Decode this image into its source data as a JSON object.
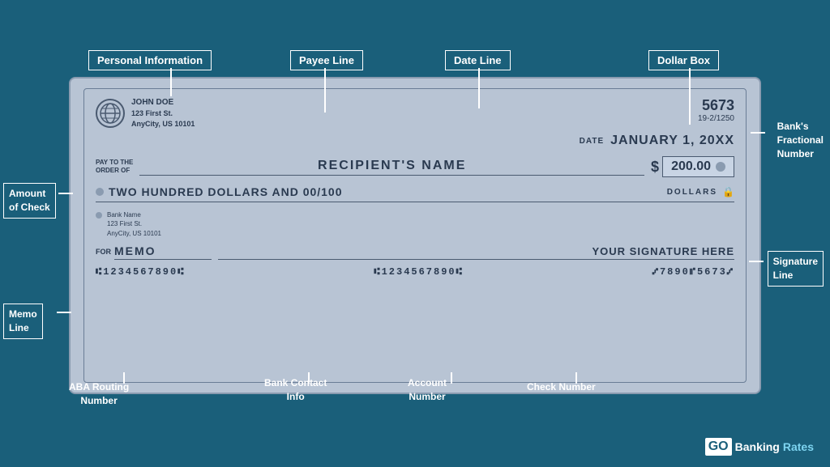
{
  "background_color": "#1a5f7a",
  "check": {
    "person_name": "JOHN DOE",
    "person_address_line1": "123 First St.",
    "person_address_line2": "AnyCity, US 10101",
    "check_number": "5673",
    "fractional_number": "19-2/1250",
    "date_label": "DATE",
    "date_value": "JANUARY 1, 20XX",
    "pay_to_label_line1": "PAY TO THE",
    "pay_to_label_line2": "ORDER OF",
    "recipient_name": "RECIPIENT'S NAME",
    "dollar_sign": "$",
    "amount_numeric": "200.00",
    "written_amount": "TWO HUNDRED DOLLARS AND 00/100",
    "dollars_label": "DOLLARS",
    "bank_name": "Bank Name",
    "bank_address_line1": "123 First St.",
    "bank_address_line2": "AnyCity, US 10101",
    "for_label": "FOR",
    "memo": "MEMO",
    "signature": "YOUR SIGNATURE HERE",
    "micr_routing": "⑆1234567890⑆",
    "micr_account": "⑆1234567890⑆",
    "micr_check": "⑇7890⑈5673⑇"
  },
  "labels": {
    "personal_information": "Personal Information",
    "payee_line": "Payee Line",
    "date_line": "Date Line",
    "dollar_box": "Dollar Box",
    "banks_fractional_number_line1": "Bank's",
    "banks_fractional_number_line2": "Fractional",
    "banks_fractional_number_line3": "Number",
    "amount_of_check_line1": "Amount",
    "amount_of_check_line2": "of Check",
    "signature_line_line1": "Signature",
    "signature_line_line2": "Line",
    "memo_line_line1": "Memo",
    "memo_line_line2": "Line",
    "aba_routing_line1": "ABA Routing",
    "aba_routing_line2": "Number",
    "bank_contact_line1": "Bank Contact",
    "bank_contact_line2": "Info",
    "account_number_line1": "Account",
    "account_number_line2": "Number",
    "check_number_line1": "Check Number"
  },
  "branding": {
    "go": "GO",
    "banking": "Banking",
    "rates": "Rates"
  }
}
